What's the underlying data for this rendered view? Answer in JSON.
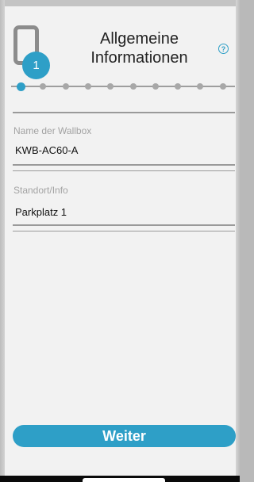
{
  "header": {
    "title_line1": "Allgemeine",
    "title_line2": "Informationen",
    "step_number": "1",
    "help_icon": "question-circle-icon",
    "device_icon": "phone-device-icon"
  },
  "progress": {
    "current_step": 1,
    "total_steps": 10
  },
  "form": {
    "wallbox_name": {
      "label": "Name der Wallbox",
      "value": "KWB-AC60-A"
    },
    "location": {
      "label": "Standort/Info",
      "value": "Parkplatz 1"
    }
  },
  "actions": {
    "next_label": "Weiter"
  },
  "colors": {
    "accent": "#2e9fc7",
    "background": "#f2f2f2"
  }
}
